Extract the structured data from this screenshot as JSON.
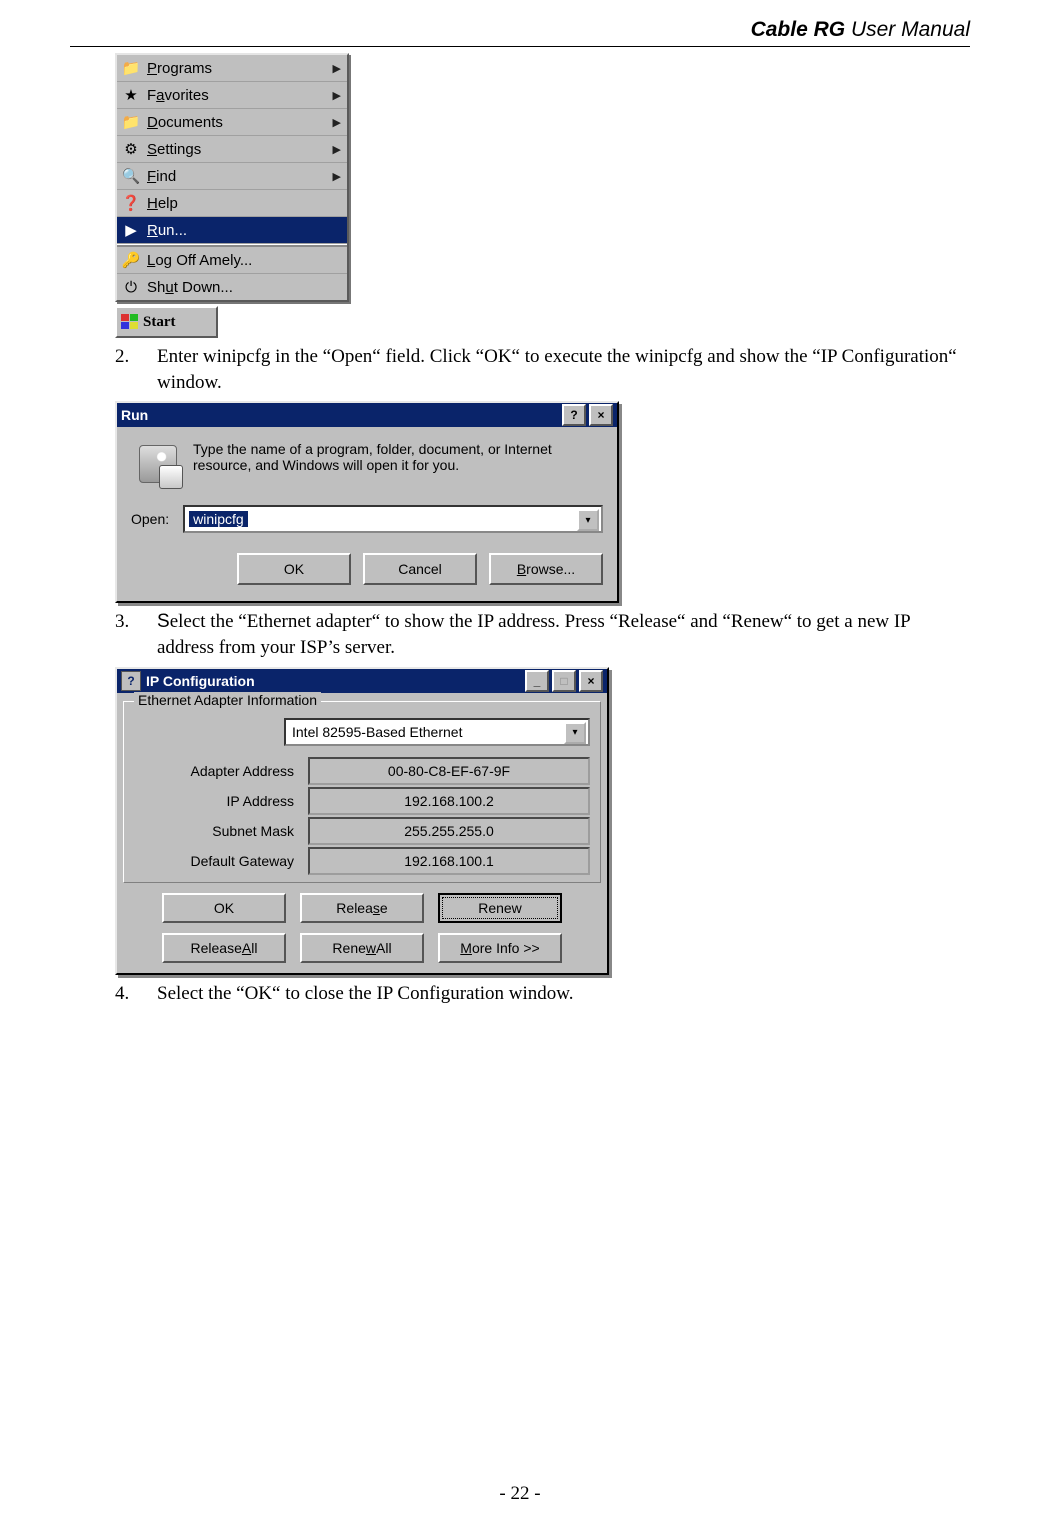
{
  "doc": {
    "title_prefix": "Cable RG ",
    "title_suffix": "User Manual",
    "page_number": "- 22 -"
  },
  "start_menu": {
    "items": [
      {
        "icon": "programs-icon",
        "label_pre": "",
        "u": "P",
        "label_post": "rograms",
        "arrow": true
      },
      {
        "icon": "favorites-icon",
        "label_pre": "F",
        "u": "a",
        "label_post": "vorites",
        "arrow": true
      },
      {
        "icon": "documents-icon",
        "label_pre": "",
        "u": "D",
        "label_post": "ocuments",
        "arrow": true
      },
      {
        "icon": "settings-icon",
        "label_pre": "",
        "u": "S",
        "label_post": "ettings",
        "arrow": true
      },
      {
        "icon": "find-icon",
        "label_pre": "",
        "u": "F",
        "label_post": "ind",
        "arrow": true
      },
      {
        "icon": "help-icon",
        "label_pre": "",
        "u": "H",
        "label_post": "elp",
        "arrow": false
      },
      {
        "icon": "run-icon",
        "label_pre": "",
        "u": "R",
        "label_post": "un...",
        "arrow": false,
        "selected": true
      },
      {
        "icon": "logoff-icon",
        "label_pre": "",
        "u": "L",
        "label_post": "og Off Amely...",
        "arrow": false
      },
      {
        "icon": "shutdown-icon",
        "label_pre": "Sh",
        "u": "u",
        "label_post": "t Down...",
        "arrow": false
      }
    ],
    "start_label": "Start"
  },
  "steps": {
    "s2": "Enter winipcfg in the “Open“ field. Click “OK“ to execute the winipcfg and show the “IP Configuration“ window.",
    "s3": "Select the “Ethernet adapter“ to show the IP address. Press “Release“ and “Renew“ to get a new IP address from your ISP’s server.",
    "s4": "Select the “OK“ to close the IP Configuration window."
  },
  "run_dialog": {
    "title": "Run",
    "message": "Type the name of a program, folder, document, or Internet resource, and Windows will open it for you.",
    "open_label": "Open:",
    "open_value": "winipcfg",
    "buttons": {
      "ok": "OK",
      "cancel": "Cancel",
      "browse": "Browse..."
    }
  },
  "ipcfg": {
    "title": "IP Configuration",
    "group": "Ethernet  Adapter Information",
    "adapter": "Intel 82595-Based Ethernet",
    "rows": {
      "adapter_address": {
        "k": "Adapter Address",
        "v": "00-80-C8-EF-67-9F"
      },
      "ip_address": {
        "k": "IP Address",
        "v": "192.168.100.2"
      },
      "subnet_mask": {
        "k": "Subnet Mask",
        "v": "255.255.255.0"
      },
      "default_gateway": {
        "k": "Default Gateway",
        "v": "192.168.100.1"
      }
    },
    "buttons": {
      "ok": "OK",
      "release": "Release",
      "renew": "Renew",
      "release_all": "Release All",
      "renew_all": "Renew All",
      "more": "More Info >>"
    }
  }
}
